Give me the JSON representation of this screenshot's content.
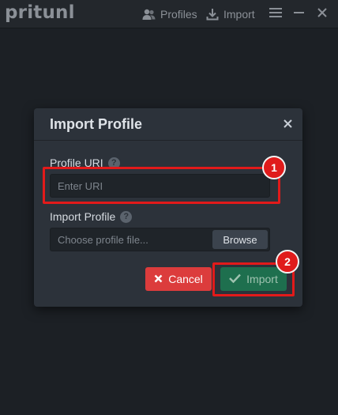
{
  "app": {
    "logo_text": "pritunl"
  },
  "nav": {
    "profiles_label": "Profiles",
    "import_label": "Import"
  },
  "window_controls": [
    "menu-icon",
    "minimize-icon",
    "close-icon"
  ],
  "modal": {
    "title": "Import Profile",
    "uri_label": "Profile URI",
    "uri_placeholder": "Enter URI",
    "file_label": "Import Profile",
    "file_placeholder": "Choose profile file...",
    "browse_label": "Browse",
    "cancel_label": "Cancel",
    "import_label": "Import"
  },
  "annotations": {
    "badge_1": "1",
    "badge_2": "2"
  },
  "colors": {
    "background": "#1c2025",
    "modal": "#2c323a",
    "cancel": "#dc3c3c",
    "import": "#1e6f4e",
    "annotation": "#e21a1a"
  }
}
